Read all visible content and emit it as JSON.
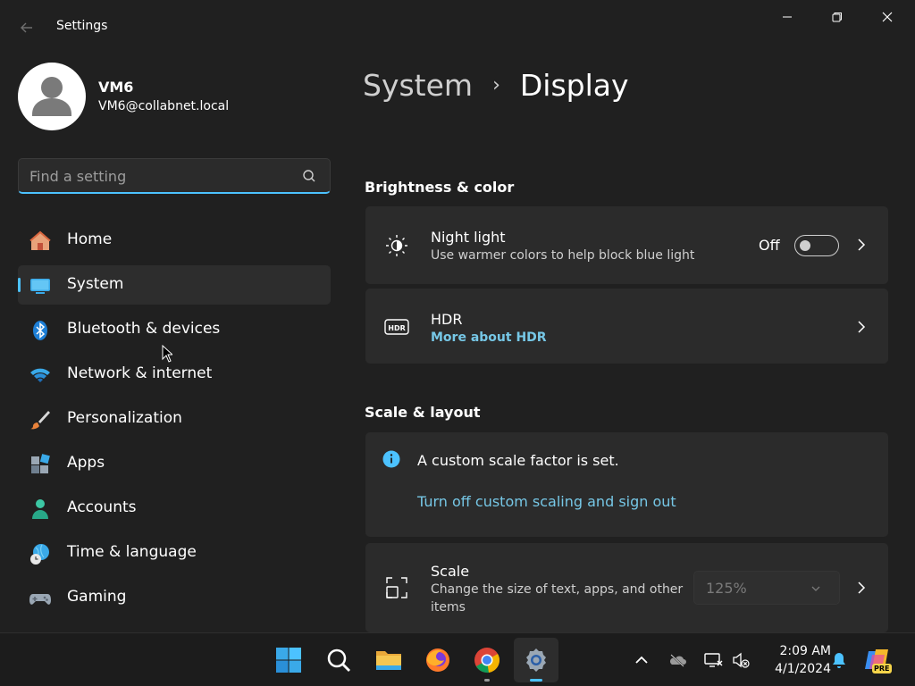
{
  "window": {
    "title": "Settings",
    "back_icon": "back-arrow-icon",
    "controls": [
      "minimize-icon",
      "restore-icon",
      "close-icon"
    ]
  },
  "profile": {
    "name": "VM6",
    "email": "VM6@collabnet.local"
  },
  "search": {
    "placeholder": "Find a setting",
    "value": ""
  },
  "sidebar": {
    "selected_index": 1,
    "items": [
      {
        "label": "Home",
        "icon": "home-icon"
      },
      {
        "label": "System",
        "icon": "system-monitor-icon"
      },
      {
        "label": "Bluetooth & devices",
        "icon": "bluetooth-icon"
      },
      {
        "label": "Network & internet",
        "icon": "wifi-icon"
      },
      {
        "label": "Personalization",
        "icon": "brush-icon"
      },
      {
        "label": "Apps",
        "icon": "apps-icon"
      },
      {
        "label": "Accounts",
        "icon": "account-icon"
      },
      {
        "label": "Time & language",
        "icon": "globe-clock-icon"
      },
      {
        "label": "Gaming",
        "icon": "gamepad-icon"
      }
    ]
  },
  "breadcrumb": {
    "parent": "System",
    "separator": "›",
    "current": "Display"
  },
  "sections": {
    "brightness": {
      "title": "Brightness & color",
      "night_light": {
        "title": "Night light",
        "subtitle": "Use warmer colors to help block blue light",
        "toggle_label": "Off",
        "toggle_on": false
      },
      "hdr": {
        "title": "HDR",
        "link": "More about HDR"
      }
    },
    "scale_layout": {
      "title": "Scale & layout",
      "notice": {
        "text": "A custom scale factor is set.",
        "link": "Turn off custom scaling and sign out"
      },
      "scale": {
        "title": "Scale",
        "subtitle_line1": "Change the size of text, apps, and other",
        "subtitle_line2": "items",
        "value": "125%"
      }
    }
  },
  "taskbar": {
    "apps": [
      "start-icon",
      "search-icon",
      "file-explorer-icon",
      "firefox-icon",
      "chrome-icon",
      "settings-icon"
    ],
    "tray": [
      "chevron-up-icon",
      "onedrive-icon",
      "network-icon",
      "volume-muted-icon"
    ],
    "time": "2:09 AM",
    "date": "4/1/2024",
    "notification_icon": "bell-icon",
    "copilot_badge": "PRE"
  },
  "colors": {
    "accent": "#4cc2ff",
    "link": "#76c7e6",
    "background": "#202020",
    "card": "#2b2b2b"
  }
}
